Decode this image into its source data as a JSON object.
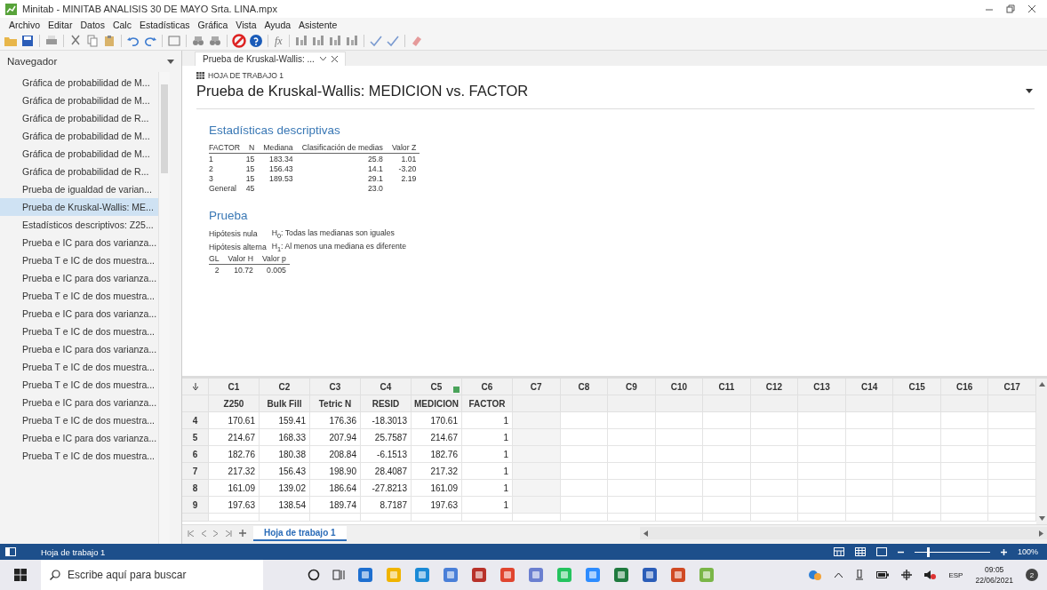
{
  "window": {
    "title": "Minitab - MINITAB ANALISIS 30 DE MAYO Srta. LINA.mpx"
  },
  "menu": [
    "Archivo",
    "Editar",
    "Datos",
    "Calc",
    "Estadísticas",
    "Gráfica",
    "Vista",
    "Ayuda",
    "Asistente"
  ],
  "toolbar": {
    "formula_label": "fx"
  },
  "navigator": {
    "title": "Navegador",
    "items": [
      {
        "label": "Gráfica de probabilidad de M...",
        "selected": false
      },
      {
        "label": "Gráfica de probabilidad de M...",
        "selected": false
      },
      {
        "label": "Gráfica de probabilidad de R...",
        "selected": false
      },
      {
        "label": "Gráfica de probabilidad de M...",
        "selected": false
      },
      {
        "label": "Gráfica de probabilidad de M...",
        "selected": false
      },
      {
        "label": "Gráfica de probabilidad de R...",
        "selected": false
      },
      {
        "label": "Prueba de igualdad de varian...",
        "selected": false
      },
      {
        "label": "Prueba de Kruskal-Wallis: ME...",
        "selected": true
      },
      {
        "label": "Estadísticos descriptivos: Z25...",
        "selected": false
      },
      {
        "label": "Prueba e IC para dos varianza...",
        "selected": false
      },
      {
        "label": "Prueba T e IC de dos muestra...",
        "selected": false
      },
      {
        "label": "Prueba e IC para dos varianza...",
        "selected": false
      },
      {
        "label": "Prueba T e IC de dos muestra...",
        "selected": false
      },
      {
        "label": "Prueba e IC para dos varianza...",
        "selected": false
      },
      {
        "label": "Prueba T e IC de dos muestra...",
        "selected": false
      },
      {
        "label": "Prueba e IC para dos varianza...",
        "selected": false
      },
      {
        "label": "Prueba T e IC de dos muestra...",
        "selected": false
      },
      {
        "label": "Prueba T e IC de dos muestra...",
        "selected": false
      },
      {
        "label": "Prueba e IC para dos varianza...",
        "selected": false
      },
      {
        "label": "Prueba T e IC de dos muestra...",
        "selected": false
      },
      {
        "label": "Prueba e IC para dos varianza...",
        "selected": false
      },
      {
        "label": "Prueba T e IC de dos muestra...",
        "selected": false
      }
    ]
  },
  "output": {
    "tab_label": "Prueba de Kruskal-Wallis: ...",
    "sheet_label": "HOJA DE TRABAJO 1",
    "title": "Prueba de Kruskal-Wallis: MEDICION vs. FACTOR",
    "descriptive": {
      "heading": "Estadísticas descriptivas",
      "columns": [
        "FACTOR",
        "N",
        "Mediana",
        "Clasificación de medias",
        "Valor Z"
      ],
      "rows": [
        [
          "1",
          "15",
          "183.34",
          "25.8",
          "1.01"
        ],
        [
          "2",
          "15",
          "156.43",
          "14.1",
          "-3.20"
        ],
        [
          "3",
          "15",
          "189.53",
          "29.1",
          "2.19"
        ],
        [
          "General",
          "45",
          "",
          "23.0",
          ""
        ]
      ]
    },
    "test": {
      "heading": "Prueba",
      "hypotheses": [
        {
          "label": "Hipótesis nula",
          "text": "H$_{0}$: Todas las medianas son iguales"
        },
        {
          "label": "Hipótesis alterna",
          "text": "H$_{1}$: Al menos una mediana es diferente"
        }
      ],
      "columns": [
        "GL",
        "Valor H",
        "Valor p"
      ],
      "rows": [
        [
          "2",
          "10.72",
          "0.005"
        ]
      ]
    }
  },
  "worksheet": {
    "column_ids": [
      "C1",
      "C2",
      "C3",
      "C4",
      "C5",
      "C6",
      "C7",
      "C8",
      "C9",
      "C10",
      "C11",
      "C12",
      "C13",
      "C14",
      "C15",
      "C16",
      "C17"
    ],
    "column_names": [
      "Z250",
      "Bulk Fill",
      "Tetric N",
      "RESID",
      "MEDICION",
      "FACTOR"
    ],
    "rows": [
      {
        "row": "4",
        "cells": [
          "170.61",
          "159.41",
          "176.36",
          "-18.3013",
          "170.61",
          "1"
        ]
      },
      {
        "row": "5",
        "cells": [
          "214.67",
          "168.33",
          "207.94",
          "25.7587",
          "214.67",
          "1"
        ]
      },
      {
        "row": "6",
        "cells": [
          "182.76",
          "180.38",
          "208.84",
          "-6.1513",
          "182.76",
          "1"
        ]
      },
      {
        "row": "7",
        "cells": [
          "217.32",
          "156.43",
          "198.90",
          "28.4087",
          "217.32",
          "1"
        ]
      },
      {
        "row": "8",
        "cells": [
          "161.09",
          "139.02",
          "186.64",
          "-27.8213",
          "161.09",
          "1"
        ]
      },
      {
        "row": "9",
        "cells": [
          "197.63",
          "138.54",
          "189.74",
          "8.7187",
          "197.63",
          "1"
        ]
      }
    ]
  },
  "sheet_tabs": [
    {
      "label": "Hoja de trabajo 1",
      "selected": true
    }
  ],
  "status_bar": {
    "text": "Hoja de trabajo 1",
    "zoom": {
      "level": 0.17
    },
    "zoom_text": "100%"
  },
  "taskbar": {
    "search_placeholder": "Escribe aquí para buscar",
    "language": "ESP",
    "time": "09:05",
    "date": "22/06/2021",
    "notifications": "2"
  }
}
